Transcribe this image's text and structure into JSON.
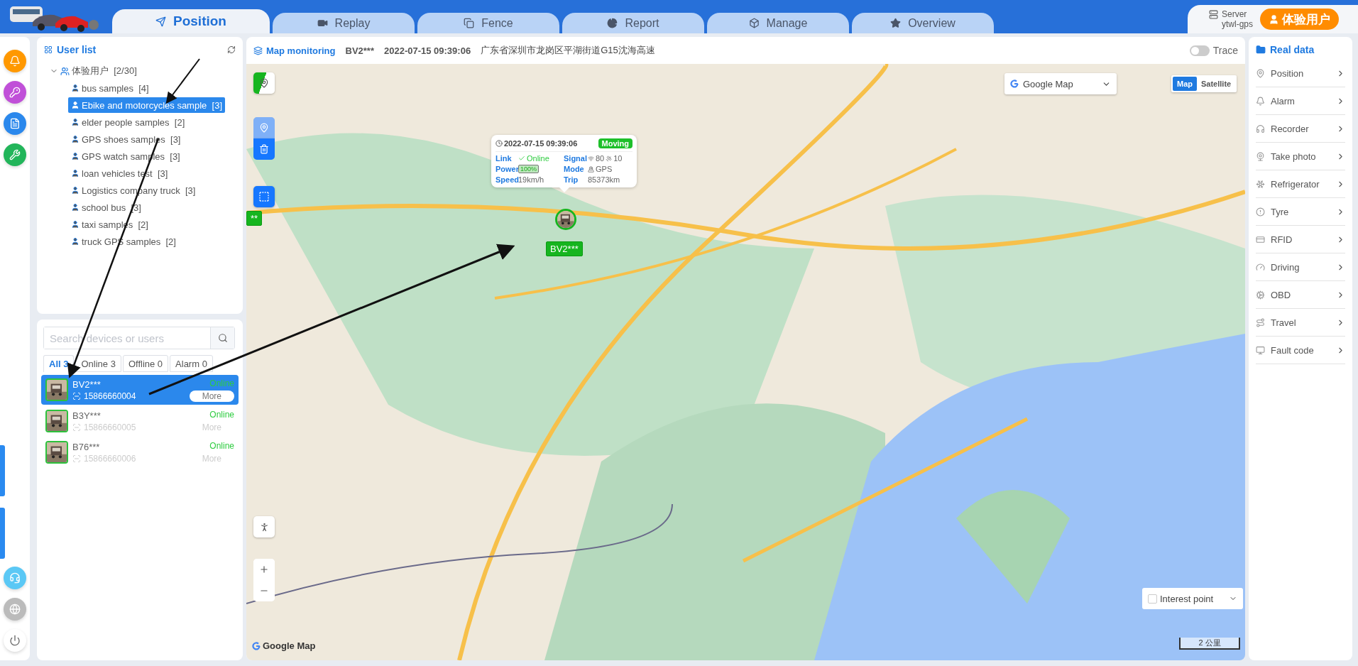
{
  "top_bar": {
    "tabs": [
      {
        "label": "Position",
        "selected": true
      },
      {
        "label": "Replay",
        "selected": false
      },
      {
        "label": "Fence",
        "selected": false
      },
      {
        "label": "Report",
        "selected": false
      },
      {
        "label": "Manage",
        "selected": false
      },
      {
        "label": "Overview",
        "selected": false
      }
    ],
    "server": {
      "label": "Server",
      "value": "ytwl-gps"
    },
    "user_button": "体验用户"
  },
  "user_list": {
    "title": "User list",
    "root": {
      "label": "体验用户",
      "count": "[2/30]",
      "expanded": true,
      "children": [
        {
          "label": "bus samples",
          "count": "[4]",
          "selected": false
        },
        {
          "label": "Ebike and motorcycles sample",
          "count": "[3]",
          "selected": true
        },
        {
          "label": "elder people samples",
          "count": "[2]",
          "selected": false
        },
        {
          "label": "GPS shoes samples",
          "count": "[3]",
          "selected": false
        },
        {
          "label": "GPS watch samples",
          "count": "[3]",
          "selected": false
        },
        {
          "label": "loan vehicles test",
          "count": "[3]",
          "selected": false
        },
        {
          "label": "Logistics company truck",
          "count": "[3]",
          "selected": false
        },
        {
          "label": "school bus",
          "count": "[3]",
          "selected": false
        },
        {
          "label": "taxi samples",
          "count": "[2]",
          "selected": false
        },
        {
          "label": "truck GPS samples",
          "count": "[2]",
          "selected": false
        }
      ]
    }
  },
  "devices": {
    "search_placeholder": "Search devices or users",
    "filters": [
      {
        "label": "All 3",
        "selected": true
      },
      {
        "label": "Online 3",
        "selected": false
      },
      {
        "label": "Offline 0",
        "selected": false
      },
      {
        "label": "Alarm 0",
        "selected": false
      }
    ],
    "items": [
      {
        "name": "BV2***",
        "phone": "15866660004",
        "status": "Online",
        "more": "More",
        "selected": true
      },
      {
        "name": "B3Y***",
        "phone": "15866660005",
        "status": "Online",
        "more": "More",
        "selected": false
      },
      {
        "name": "B76***",
        "phone": "15866660006",
        "status": "Online",
        "more": "More",
        "selected": false
      }
    ]
  },
  "map": {
    "title": "Map monitoring",
    "device": "BV2***",
    "time": "2022-07-15 09:39:06",
    "address": "广东省深圳市龙岗区平湖街道G15沈海高速",
    "trace": {
      "label": "Trace",
      "on": false
    },
    "map_select": "Google Map",
    "map_types": [
      {
        "label": "Map",
        "selected": true
      },
      {
        "label": "Satellite",
        "selected": false
      }
    ],
    "popup": {
      "time": "2022-07-15 09:39:06",
      "status": "Moving",
      "fields": [
        {
          "kind": "link",
          "label": "Link",
          "value": "Online"
        },
        {
          "kind": "signal",
          "label": "Signal",
          "value": "80",
          "extra": "10"
        },
        {
          "kind": "battery",
          "label": "Power",
          "value": "100%"
        },
        {
          "kind": "mode",
          "label": "Mode",
          "value": "GPS"
        },
        {
          "kind": "plain",
          "label": "Speed",
          "value": "19km/h"
        },
        {
          "kind": "plain",
          "label": "Trip",
          "value": "85373km"
        }
      ]
    },
    "marker_label": "BV2***",
    "edge_marker_label": "**",
    "interest_point": {
      "label": "Interest point",
      "checked": false
    },
    "scale": "2 公里",
    "attribution": "Google Map"
  },
  "real_data": {
    "title": "Real data",
    "items": [
      "Position",
      "Alarm",
      "Recorder",
      "Take photo",
      "Refrigerator",
      "Tyre",
      "RFID",
      "Driving",
      "OBD",
      "Travel",
      "Fault code"
    ]
  }
}
